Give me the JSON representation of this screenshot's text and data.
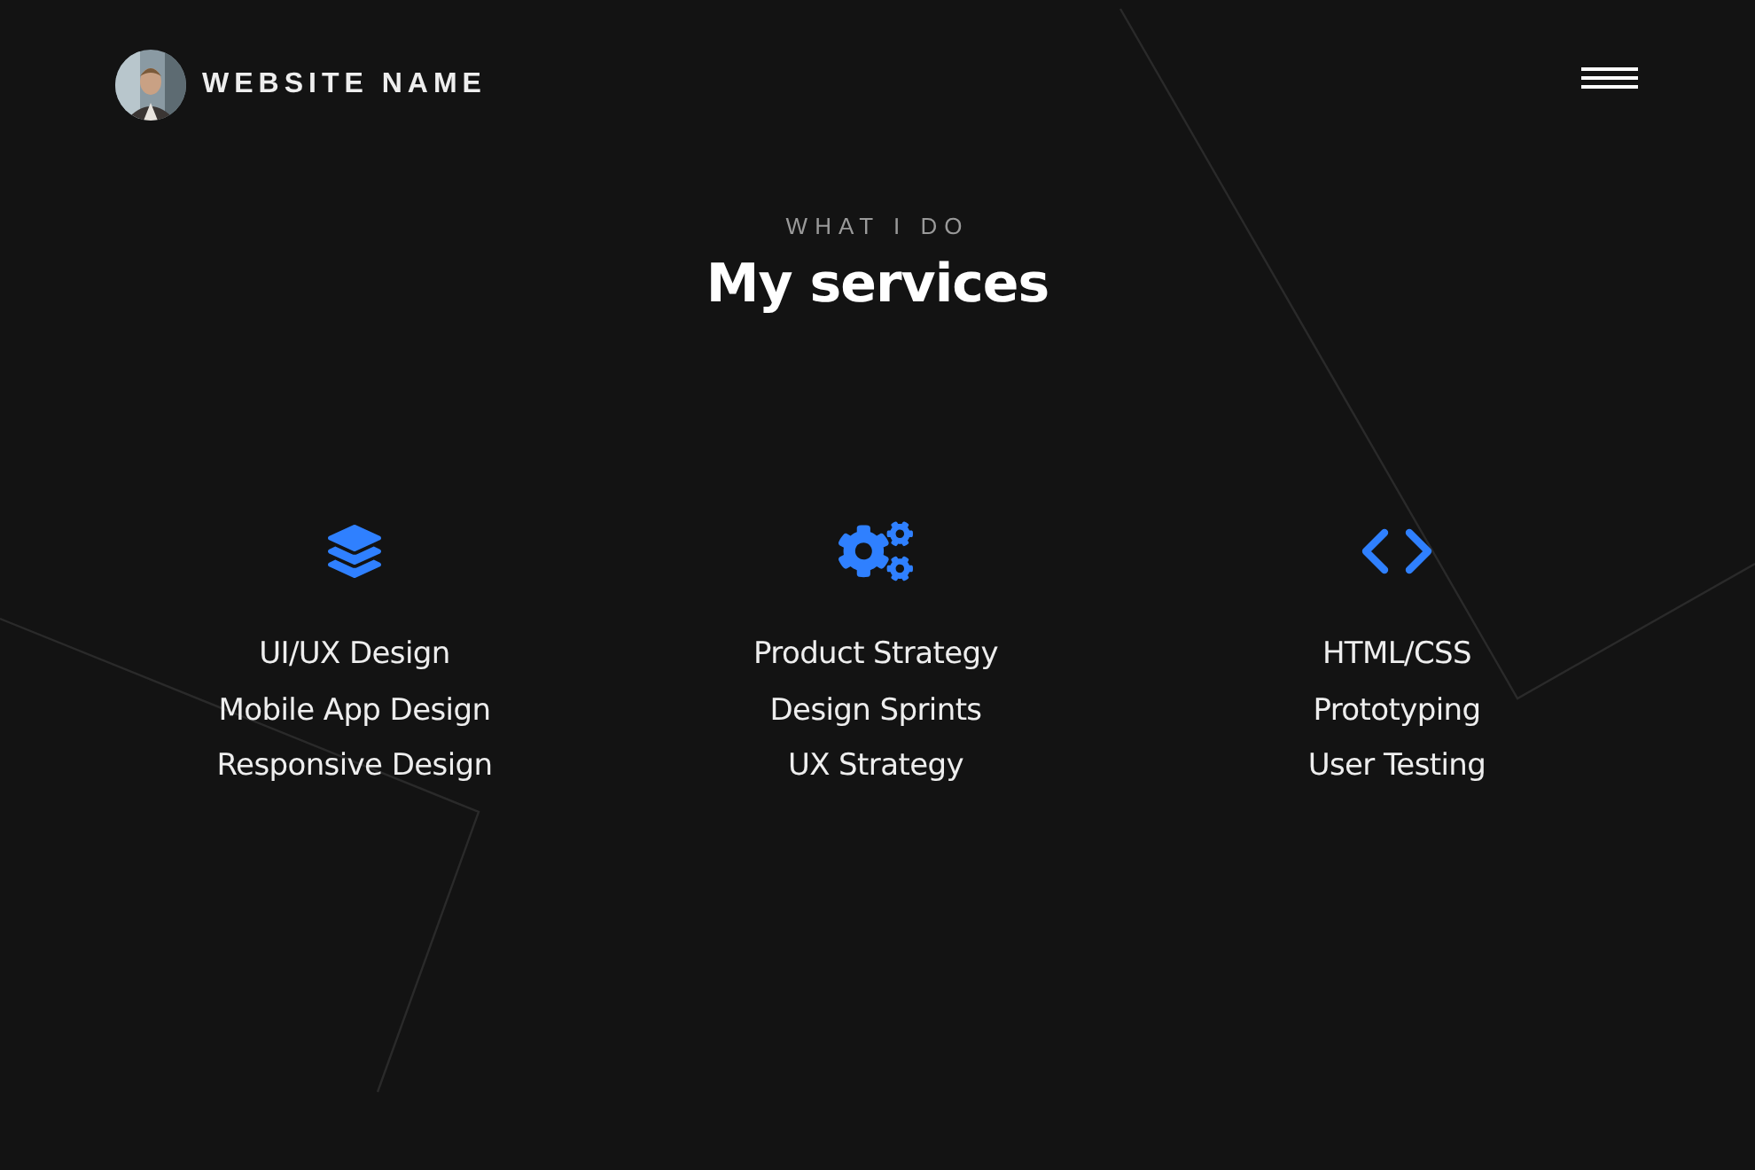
{
  "header": {
    "site_name": "WEBSITE NAME"
  },
  "section": {
    "eyebrow": "WHAT I DO",
    "title": "My services"
  },
  "services": [
    {
      "kind": "layers",
      "items": [
        "UI/UX Design",
        "Mobile App Design",
        "Responsive Design"
      ]
    },
    {
      "kind": "gears",
      "items": [
        "Product Strategy",
        "Design Sprints",
        "UX Strategy"
      ]
    },
    {
      "kind": "code",
      "items": [
        "HTML/CSS",
        "Prototyping",
        "User Testing"
      ]
    }
  ]
}
